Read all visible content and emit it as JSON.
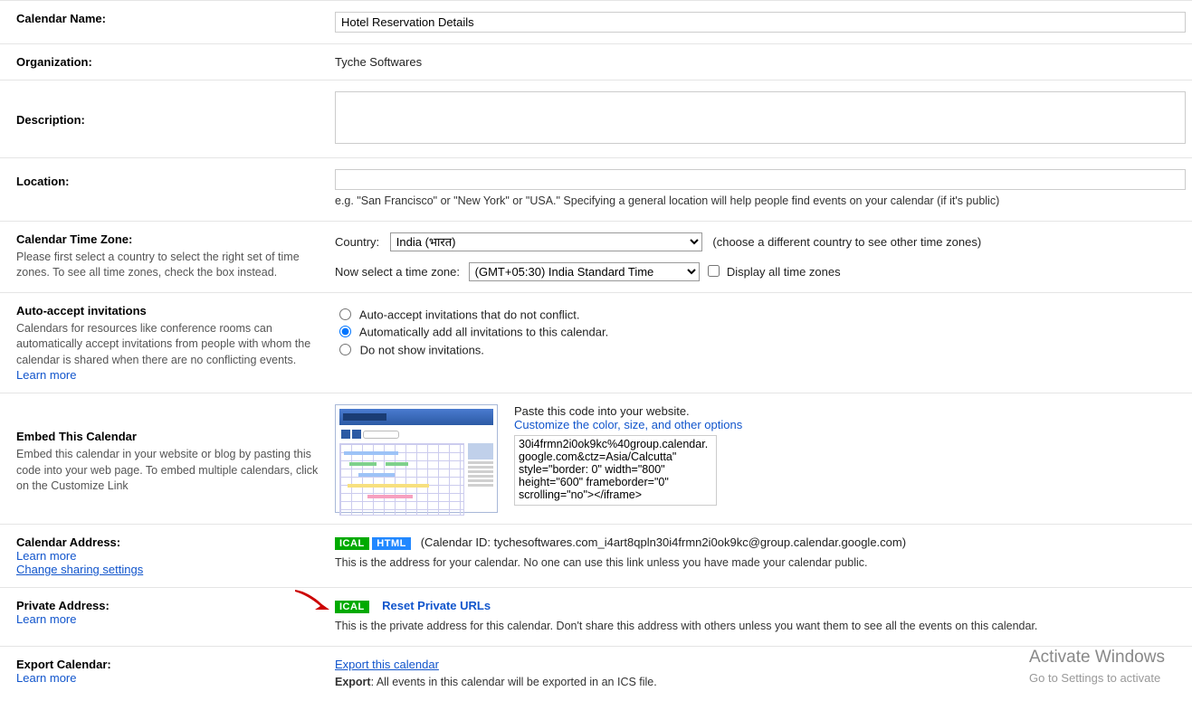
{
  "calendar_name": {
    "label": "Calendar Name:",
    "value": "Hotel Reservation Details"
  },
  "organization": {
    "label": "Organization:",
    "value": "Tyche Softwares"
  },
  "description": {
    "label": "Description:",
    "value": ""
  },
  "location": {
    "label": "Location:",
    "value": "",
    "hint_prefix": "e.g. \"San Francisco\" or \"New York\" or \"USA.\" Specifying a general location will help people find events on your calendar (if it's public)"
  },
  "timezone": {
    "label": "Calendar Time Zone:",
    "help": "Please first select a country to select the right set of time zones. To see all time zones, check the box instead.",
    "country_label": "Country:",
    "country_value": "India (भारत)",
    "country_hint": "(choose a different country to see other time zones)",
    "tz_label": "Now select a time zone:",
    "tz_value": "(GMT+05:30) India Standard Time",
    "display_all": "Display all time zones"
  },
  "auto_accept": {
    "label": "Auto-accept invitations",
    "help": "Calendars for resources like conference rooms can automatically accept invitations from people with whom the calendar is shared when there are no conflicting events.",
    "learn_more": "Learn more",
    "options": [
      "Auto-accept invitations that do not conflict.",
      "Automatically add all invitations to this calendar.",
      "Do not show invitations."
    ],
    "selected": 1
  },
  "embed": {
    "label": "Embed This Calendar",
    "help": "Embed this calendar in your website or blog by pasting this code into your web page. To embed multiple calendars, click on the Customize Link",
    "paste": "Paste this code into your website.",
    "customize": "Customize the color, size, and other options",
    "code": "30i4frmn2i0ok9kc%40group.calendar.google.com&ctz=Asia/Calcutta\" style=\"border: 0\" width=\"800\" height=\"600\" frameborder=\"0\" scrolling=\"no\"></iframe>"
  },
  "calendar_address": {
    "label": "Calendar Address:",
    "learn_more": "Learn more",
    "change_sharing": "Change sharing settings",
    "badges": {
      "ical": "ICAL",
      "html": "HTML"
    },
    "id_label": "(Calendar ID: tychesoftwares.com_i4art8qpln30i4frmn2i0ok9kc@group.calendar.google.com)",
    "desc": "This is the address for your calendar. No one can use this link unless you have made your calendar public."
  },
  "private_address": {
    "label": "Private Address:",
    "learn_more": "Learn more",
    "badge": "ICAL",
    "reset": "Reset Private URLs",
    "desc": "This is the private address for this calendar. Don't share this address with others unless you want them to see all the events on this calendar."
  },
  "export": {
    "label": "Export Calendar:",
    "learn_more": "Learn more",
    "link": "Export this calendar",
    "desc_prefix": "Export",
    "desc_rest": ": All events in this calendar will be exported in an ICS file."
  },
  "activate": {
    "title": "Activate Windows",
    "sub": "Go to Settings to activate "
  }
}
